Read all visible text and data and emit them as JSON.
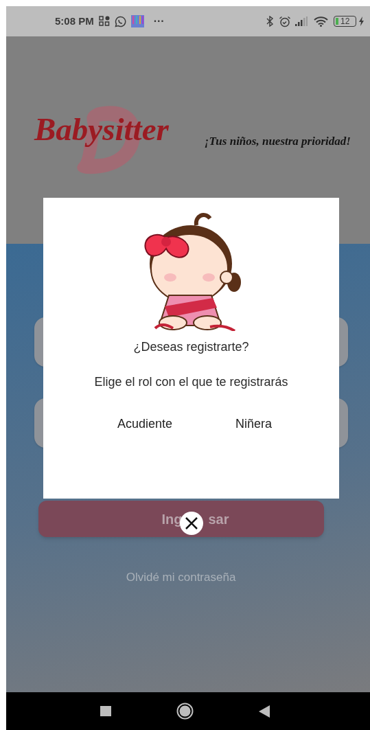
{
  "status_bar": {
    "time": "5:08 PM",
    "overflow": "···",
    "battery": "12"
  },
  "header": {
    "logo": "Babysitter",
    "tagline": "¡Tus niños, nuestra prioridad!"
  },
  "login": {
    "fields": [
      {
        "kind": "field"
      },
      {
        "kind": "field"
      }
    ],
    "button_label_parts": [
      "Ing",
      "sar"
    ],
    "forgot_link": "Olvidé mi contraseña"
  },
  "dialog": {
    "title": "¿Deseas registrarte?",
    "subtitle": "Elige el rol con el que te registrarás",
    "options": [
      "Acudiente",
      "Niñera"
    ]
  }
}
